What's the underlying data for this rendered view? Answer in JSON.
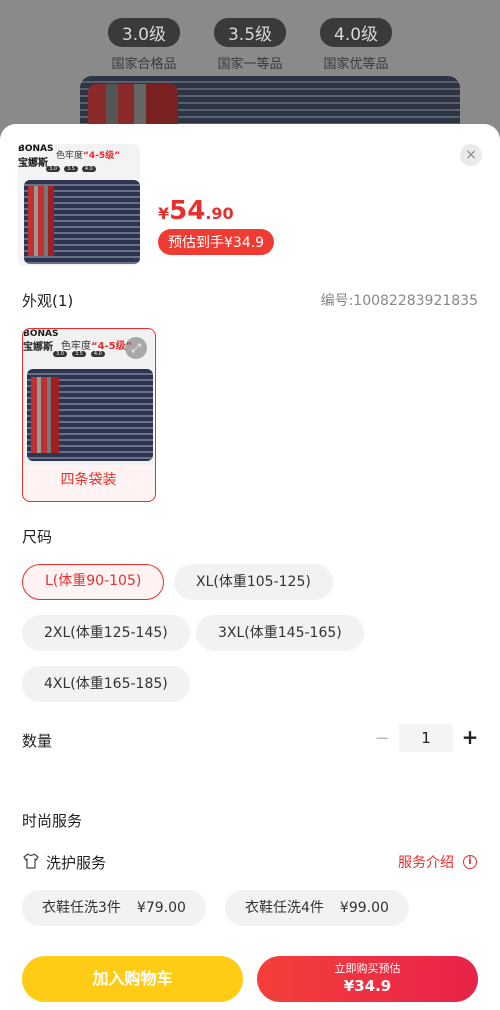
{
  "background": {
    "badges": [
      {
        "level": "3.0级",
        "caption": "国家合格品"
      },
      {
        "level": "3.5级",
        "caption": "国家一等品"
      },
      {
        "level": "4.0级",
        "caption": "国家优等品"
      }
    ]
  },
  "product": {
    "thumb_brand": "BONAS",
    "thumb_brand_cn": "宝娜斯",
    "thumb_title_prefix": "色牢度",
    "thumb_title_highlight": "“4-5级”",
    "price_symbol": "¥",
    "price_integer": "54",
    "price_decimal": ".90",
    "estimate_label": "预估到手¥34.9",
    "close_icon": "×"
  },
  "appearance": {
    "label": "外观(1)",
    "code": "编号:10082283921835",
    "variants": [
      {
        "name": "四条袋装",
        "selected": true
      }
    ]
  },
  "size": {
    "label": "尺码",
    "options": [
      {
        "label": "L(体重90-105)",
        "selected": true
      },
      {
        "label": "XL(体重105-125)",
        "selected": false
      },
      {
        "label": "2XL(体重125-145)",
        "selected": false
      },
      {
        "label": "3XL(体重145-165)",
        "selected": false
      },
      {
        "label": "4XL(体重165-185)",
        "selected": false
      }
    ]
  },
  "quantity": {
    "label": "数量",
    "minus": "−",
    "value": "1",
    "plus": "+"
  },
  "services": {
    "label": "时尚服务",
    "wash_label": "洗护服务",
    "intro_label": "服务介绍",
    "info_icon": "i",
    "options": [
      {
        "name": "衣鞋任洗3件",
        "price": "¥79.00"
      },
      {
        "name": "衣鞋任洗4件",
        "price": "¥99.00"
      }
    ]
  },
  "actions": {
    "add_to_cart": "加入购物车",
    "buy_now_line1": "立即购买预估",
    "buy_now_line2": "¥34.9"
  },
  "colors": {
    "accent": "#e5302e",
    "cart_button": "#ffcb14",
    "buy_button": "#f43f3a"
  }
}
